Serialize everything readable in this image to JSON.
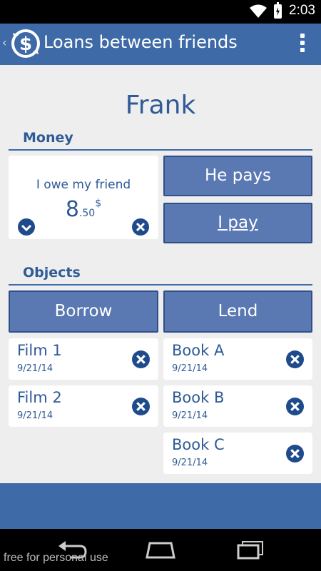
{
  "status_bar": {
    "time": "2:03"
  },
  "app_bar": {
    "title": "Loans between friends",
    "back_glyph": "‹",
    "logo_glyph": "$"
  },
  "friend": {
    "name": "Frank"
  },
  "money": {
    "section_title": "Money",
    "owe_label": "I owe my friend",
    "amount_int": "8",
    "amount_dec": ".50",
    "currency": "$",
    "he_pays_label": "He pays",
    "i_pay_label": "I pay"
  },
  "objects": {
    "section_title": "Objects",
    "borrow_label": "Borrow",
    "lend_label": "Lend",
    "borrowed": [
      {
        "name": "Film 1",
        "date": "9/21/14"
      },
      {
        "name": "Film 2",
        "date": "9/21/14"
      }
    ],
    "lent": [
      {
        "name": "Book A",
        "date": "9/21/14"
      },
      {
        "name": "Book B",
        "date": "9/21/14"
      },
      {
        "name": "Book C",
        "date": "9/21/14"
      }
    ]
  },
  "nav_bar": {
    "watermark": "free for personal use"
  },
  "colors": {
    "primary": "#3e6aa7",
    "button": "#5a78b1",
    "text": "#2e5a96",
    "icon": "#1f4b8c"
  },
  "icons": [
    "wifi-icon",
    "battery-icon",
    "app-logo-icon",
    "overflow-menu-icon",
    "chevron-down-icon",
    "close-icon",
    "back-icon",
    "home-icon",
    "recents-icon"
  ]
}
